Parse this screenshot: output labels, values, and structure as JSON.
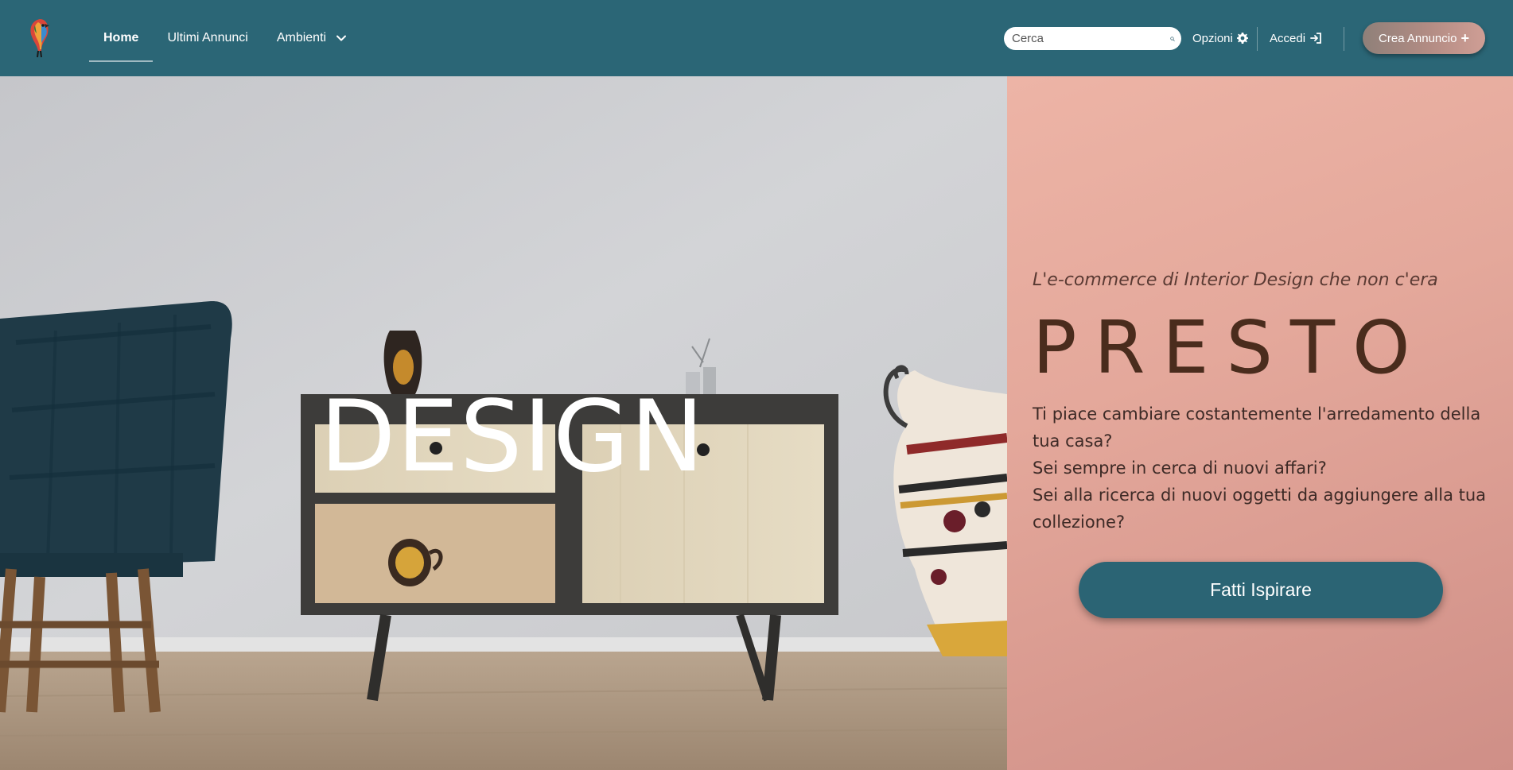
{
  "nav": {
    "logo_icon": "parrot-logo-icon",
    "links": [
      {
        "label": "Home",
        "active": true
      },
      {
        "label": "Ultimi Annunci",
        "active": false
      },
      {
        "label": "Ambienti",
        "active": false,
        "icon": "chevron-down-icon"
      }
    ],
    "search": {
      "placeholder": "Cerca",
      "value": "",
      "icon": "search-icon"
    },
    "options_label": "Opzioni",
    "options_icon": "gear-icon",
    "login_label": "Accedi",
    "login_icon": "sign-in-icon",
    "create_label": "Crea Annuncio",
    "create_icon": "+"
  },
  "hero": {
    "overlay_word": "DESIGN",
    "tagline": "L'e-commerce di Interior Design che non c'era",
    "brand": "PRESTO",
    "questions": [
      "Ti piace cambiare costantemente l'arredamento della tua casa?",
      "Sei sempre in cerca di nuovi affari?",
      "Sei alla ricerca di nuovi oggetti da aggiungere alla tua collezione?"
    ],
    "cta_label": "Fatti Ispirare"
  },
  "colors": {
    "navbar": "#2b6676",
    "cta": "#2b6474",
    "panel_pink": "#e4a89b",
    "brand_text": "#4a2c1d",
    "create_button": "#b38c84"
  }
}
